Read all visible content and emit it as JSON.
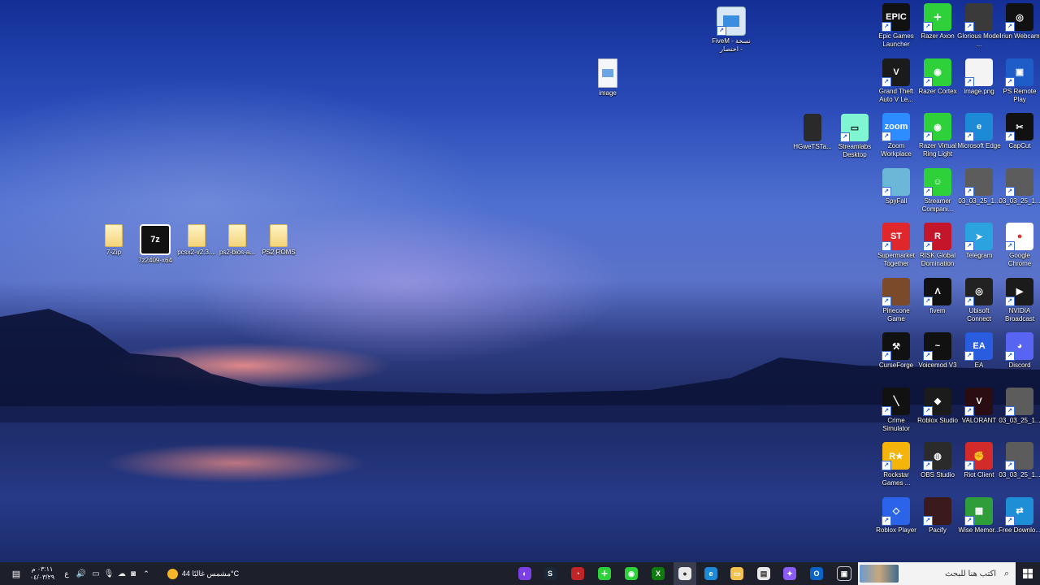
{
  "desktop": {
    "left_icons": [
      {
        "label": "7-Zip",
        "icon": "folder-icon"
      },
      {
        "label": "7z2409-x64",
        "icon": "7zip-installer-icon"
      },
      {
        "label": "pcsx2-v2.3....",
        "icon": "folder-icon"
      },
      {
        "label": "ps2-bios-a...",
        "icon": "folder-icon"
      },
      {
        "label": "PS2 ROMS",
        "icon": "folder-icon"
      }
    ],
    "middle_icons": [
      {
        "label": "FiveM - نسخة اختصار -",
        "icon": "fivem-shortcut-icon"
      },
      {
        "label": "image",
        "icon": "image-file-icon"
      },
      {
        "label": "HGweTSTa...",
        "icon": "file-icon"
      },
      {
        "label": "Streamlabs Desktop",
        "icon": "streamlabs-icon"
      }
    ],
    "grid": [
      [
        {
          "label": "Epic Games Launcher",
          "text": "EPIC",
          "color": "#111111"
        },
        {
          "label": "Razer Axon",
          "text": "✛",
          "color": "#2fd13b"
        },
        {
          "label": "Glorious Model ...",
          "text": "",
          "color": "#3a3a3a"
        },
        {
          "label": "Iriun Webcam",
          "text": "◎",
          "color": "#111111"
        }
      ],
      [
        {
          "label": "Grand Theft Auto V Le...",
          "text": "V",
          "color": "#1b1b1b"
        },
        {
          "label": "Razer Cortex",
          "text": "◉",
          "color": "#2fd13b"
        },
        {
          "label": "image.png",
          "text": "",
          "color": "#f4f4f4"
        },
        {
          "label": "PS Remote Play",
          "text": "▣",
          "color": "#1e5cc8"
        }
      ],
      [
        {
          "label": "Zoom Workplace",
          "text": "zoom",
          "color": "#2d8cff"
        },
        {
          "label": "Razer Virtual Ring Light",
          "text": "◉",
          "color": "#2fd13b"
        },
        {
          "label": "Microsoft Edge",
          "text": "e",
          "color": "#1d8ad8"
        },
        {
          "label": "CapCut",
          "text": "✂",
          "color": "#111111"
        }
      ],
      [
        {
          "label": "SpyFall",
          "text": "",
          "color": "#6ab7d8"
        },
        {
          "label": "Streamer Compani...",
          "text": "☺",
          "color": "#2fd13b"
        },
        {
          "label": "03_03_25_1...",
          "text": "",
          "color": "#5c5c5c"
        },
        {
          "label": "03_03_25_1...",
          "text": "",
          "color": "#5c5c5c"
        }
      ],
      [
        {
          "label": "Supermarket Together",
          "text": "ST",
          "color": "#e0282c"
        },
        {
          "label": "RISK Global Domination",
          "text": "R",
          "color": "#c4162a"
        },
        {
          "label": "Telegram",
          "text": "➤",
          "color": "#2aa3de"
        },
        {
          "label": "Google Chrome",
          "text": "●",
          "color": "#ffffff"
        }
      ],
      [
        {
          "label": "Pinecone Game",
          "text": "",
          "color": "#7a4a2a"
        },
        {
          "label": "fivem",
          "text": "Λ",
          "color": "#111111"
        },
        {
          "label": "Ubisoft Connect",
          "text": "◎",
          "color": "#222222"
        },
        {
          "label": "NVIDIA Broadcast",
          "text": "▶",
          "color": "#1b1b1b"
        }
      ],
      [
        {
          "label": "CurseForge",
          "text": "⚒",
          "color": "#111111"
        },
        {
          "label": "Voicemod V3",
          "text": "~",
          "color": "#111111"
        },
        {
          "label": "EA",
          "text": "EA",
          "color": "#2a5ce0"
        },
        {
          "label": "Discord",
          "text": "◕",
          "color": "#5865f2"
        }
      ],
      [
        {
          "label": "Crime Simulator",
          "text": "╲",
          "color": "#111111"
        },
        {
          "label": "Roblox Studio",
          "text": "◆",
          "color": "#1b1b1b"
        },
        {
          "label": "VALORANT",
          "text": "V",
          "color": "#2a0d12"
        },
        {
          "label": "03_03_25_1...",
          "text": "",
          "color": "#5c5c5c"
        }
      ],
      [
        {
          "label": "Rockstar Games ...",
          "text": "R★",
          "color": "#f5b40a"
        },
        {
          "label": "OBS Studio",
          "text": "◍",
          "color": "#2b2b2b"
        },
        {
          "label": "Riot Client",
          "text": "✊",
          "color": "#d32a2a"
        },
        {
          "label": "03_03_25_1...",
          "text": "",
          "color": "#5c5c5c"
        }
      ],
      [
        {
          "label": "Roblox Player",
          "text": "◇",
          "color": "#2b64e8"
        },
        {
          "label": "Pacify",
          "text": "",
          "color": "#3a1a1a"
        },
        {
          "label": "Wise Memor...",
          "text": "▦",
          "color": "#2f9e3a"
        },
        {
          "label": "Free Downlo...",
          "text": "⇄",
          "color": "#1e8fd6"
        }
      ]
    ]
  },
  "taskbar": {
    "search_placeholder": "اكتب هنا للبحث",
    "weather_text": "مشمس غالبًا 44°C",
    "clock_time": "٠٣:١١ م",
    "clock_date": "٠٤/٠٣/٢٩",
    "lang": "ع",
    "apps": [
      {
        "name": "app-icon-1",
        "text": "◐",
        "color": "#7b3fe4"
      },
      {
        "name": "steam-icon",
        "text": "S",
        "color": "#1b2838"
      },
      {
        "name": "app-icon-3",
        "text": "◔",
        "color": "#c02424"
      },
      {
        "name": "razer-icon",
        "text": "✛",
        "color": "#2fd13b"
      },
      {
        "name": "razer-cortex-icon",
        "text": "◉",
        "color": "#2fd13b"
      },
      {
        "name": "xbox-icon",
        "text": "X",
        "color": "#107c10"
      },
      {
        "name": "chrome-icon",
        "text": "●",
        "color": "#e9e9e9"
      },
      {
        "name": "edge-icon",
        "text": "e",
        "color": "#1d8ad8"
      },
      {
        "name": "file-explorer-icon",
        "text": "▭",
        "color": "#f2c14e"
      },
      {
        "name": "store-icon",
        "text": "▤",
        "color": "#e9e9e9"
      },
      {
        "name": "copilot-icon",
        "text": "✦",
        "color": "#8b5cf6"
      },
      {
        "name": "outlook-icon",
        "text": "O",
        "color": "#0a64c8"
      },
      {
        "name": "task-view-icon",
        "text": "▣",
        "color": "#1d1f2b"
      }
    ]
  }
}
